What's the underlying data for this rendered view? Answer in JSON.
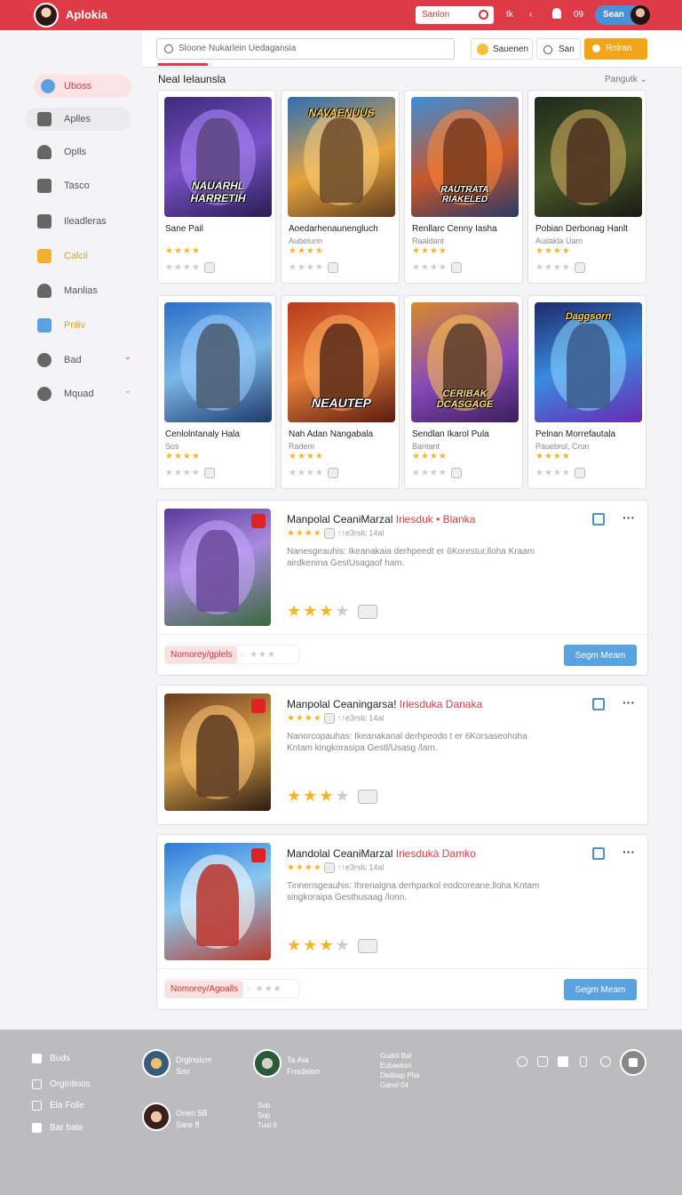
{
  "topbar": {
    "title": "Aplokia",
    "search_label": "Sanlon",
    "tab_label": "tk",
    "count_label": "09",
    "button_label": "Sean"
  },
  "subbar": {
    "search_placeholder": "Sloone Nukarlein Uedagansia",
    "btn1": "Sauenen",
    "btn2": "San",
    "btn3": "Rnlran"
  },
  "sidebar": {
    "items": [
      {
        "label": "Uboss"
      },
      {
        "label": "Aplles"
      },
      {
        "label": "Oplls"
      },
      {
        "label": "Tasco"
      },
      {
        "label": "Ileadleras"
      },
      {
        "label": "Calcil"
      },
      {
        "label": "Manlias"
      },
      {
        "label": "Pnliv"
      },
      {
        "label": "Bad"
      },
      {
        "label": "Mquad"
      }
    ]
  },
  "main": {
    "heading": "Neal Ielaunsla",
    "sort_label": "Pangutk"
  },
  "cards": [
    {
      "title": "Sane Pail",
      "subtitle": "",
      "banner": "NAUARHL HARRETIH"
    },
    {
      "title": "Aoedarhenaunengluch",
      "subtitle": "Aubelunn",
      "banner": "NAVAENUUS"
    },
    {
      "title": "Renllarc Cenny Iasha",
      "subtitle": "Raaldant",
      "banner": "RAUTRATA RIAKELED"
    },
    {
      "title": "Pobian Derbonag Hanlt",
      "subtitle": "Auilakla Uam",
      "banner": ""
    },
    {
      "title": "Cenlolntanaly Hala",
      "subtitle": "Sos",
      "banner": ""
    },
    {
      "title": "Nah Adan Nangabala",
      "subtitle": "Radem",
      "banner": "NEAUTEP"
    },
    {
      "title": "Sendlan Ikarol Pula",
      "subtitle": "Baritant",
      "banner": "CERIBAK DCASGAGE"
    },
    {
      "title": "Pelnan Morrefautala",
      "subtitle": "Pauebrul, Crun",
      "banner": "Daggsorn"
    }
  ],
  "list": [
    {
      "title": "Manpolal CeaniMarzal",
      "title_red": "Iriesduk • Blanka",
      "meta": "↑↑e3rslc 14al",
      "desc": "Nanesgeauhis: Ikeanakaia derhpeedt er 6Korestur,lloha Kraam airdkenina GestUsagaof ham.",
      "chip": "Nomorey/gplels",
      "button": "Segm Meam"
    },
    {
      "title": "Manpolal Ceaningarsa!",
      "title_red": "Iriesduka Danaka",
      "meta": "↑↑e3rslc 14al",
      "desc": "Nanorcopauhas: Ikeanakanal derhpeodo t er 6Korsaseohoha Kntam kingkorasipa Gestl/Usasg /lam.",
      "chip": "",
      "button": ""
    },
    {
      "title": "Mandolal CeaniMarzal",
      "title_red": "Iriesdukà Damko",
      "meta": "↑↑e3rslc 14al",
      "desc": "Tinnensgeauhis: Ihrenalgna derhparkol eodcoreane,lloha Kntam singkoraipa Gesthusaag /lonn.",
      "chip": "Nomorey/Agoalls",
      "button": "Segm Meam"
    }
  ],
  "footer": {
    "links": [
      {
        "label": "Buds"
      },
      {
        "label": "Orgintinos"
      },
      {
        "label": "Ela Folle"
      },
      {
        "label": "Bar bala"
      }
    ],
    "users": [
      {
        "name": "Drglnolcm",
        "sub": "Son"
      },
      {
        "name": "Ta Aia",
        "sub": "Fnsdelon"
      },
      {
        "name": "Onen 5B",
        "sub": "Sare 8"
      }
    ],
    "col3": [
      "Gudol Bal",
      "Eubaeksn",
      "Dedaap Pha",
      "Gansl 04"
    ],
    "col4": [
      "Sob",
      "Sop",
      "Tual 5"
    ]
  }
}
